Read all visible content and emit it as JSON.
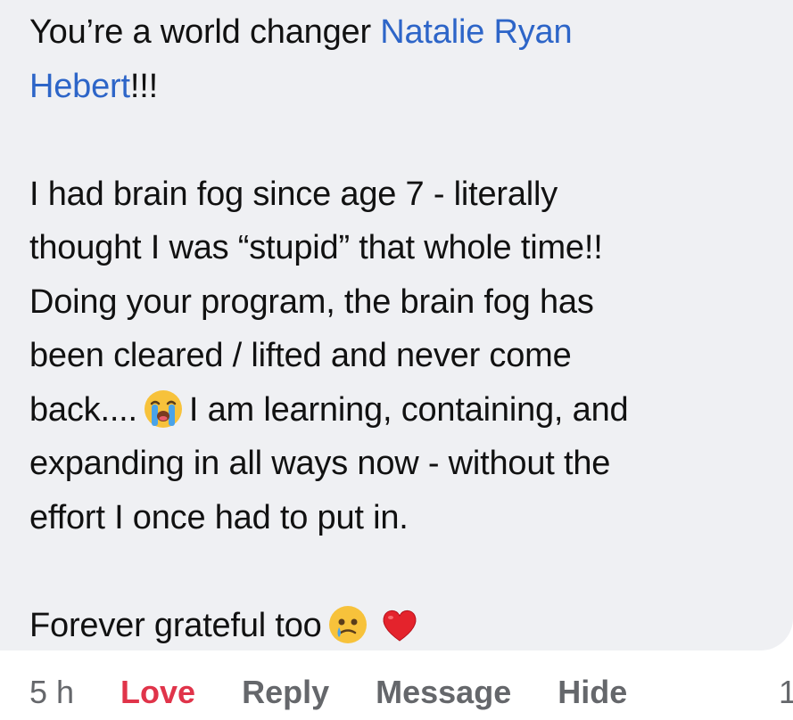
{
  "comment": {
    "line1_prefix": "You’re a world changer ",
    "mention_part1": "Natalie Ryan",
    "mention_part2": "Hebert",
    "line2_suffix": "!!!",
    "para2_line1": "I had brain fog since age 7 - literally",
    "para2_line2": "thought I was “stupid” that whole time!!",
    "para2_line3": "Doing your program, the brain fog has",
    "para2_line4": "been cleared / lifted and never come",
    "para2_line5_prefix": "back....",
    "para2_line5_emoji": "loudly-crying-face-emoji",
    "para2_line5_suffix": "I am learning, containing, and",
    "para2_line6": "expanding in all ways now - without the",
    "para2_line7": "effort I once had to put in.",
    "para3_text": "Forever grateful too",
    "para3_emoji1": "face-holding-back-tears-emoji",
    "para3_emoji2": "red-heart-emoji"
  },
  "actions": {
    "timestamp": "5 h",
    "love_label": "Love",
    "reply_label": "Reply",
    "message_label": "Message",
    "hide_label": "Hide",
    "reaction_count": "1"
  },
  "colors": {
    "bubble_bg": "#eff0f3",
    "mention": "#2d65c8",
    "love": "#e0344a",
    "meta": "#65676b"
  }
}
